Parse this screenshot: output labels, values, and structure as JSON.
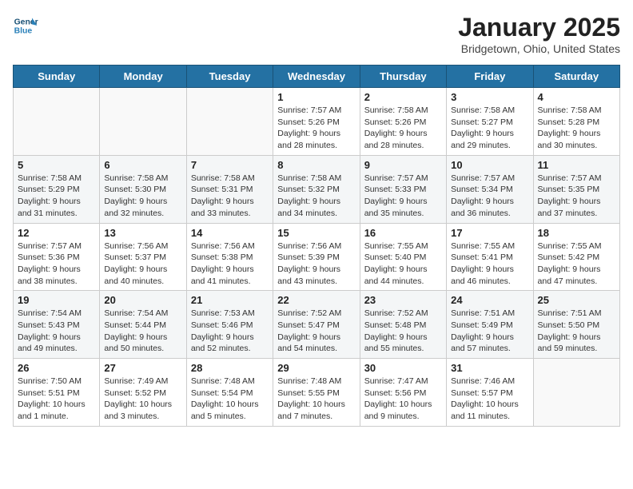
{
  "header": {
    "logo_line1": "General",
    "logo_line2": "Blue",
    "title": "January 2025",
    "subtitle": "Bridgetown, Ohio, United States"
  },
  "weekdays": [
    "Sunday",
    "Monday",
    "Tuesday",
    "Wednesday",
    "Thursday",
    "Friday",
    "Saturday"
  ],
  "weeks": [
    [
      {
        "day": "",
        "info": ""
      },
      {
        "day": "",
        "info": ""
      },
      {
        "day": "",
        "info": ""
      },
      {
        "day": "1",
        "info": "Sunrise: 7:57 AM\nSunset: 5:26 PM\nDaylight: 9 hours\nand 28 minutes."
      },
      {
        "day": "2",
        "info": "Sunrise: 7:58 AM\nSunset: 5:26 PM\nDaylight: 9 hours\nand 28 minutes."
      },
      {
        "day": "3",
        "info": "Sunrise: 7:58 AM\nSunset: 5:27 PM\nDaylight: 9 hours\nand 29 minutes."
      },
      {
        "day": "4",
        "info": "Sunrise: 7:58 AM\nSunset: 5:28 PM\nDaylight: 9 hours\nand 30 minutes."
      }
    ],
    [
      {
        "day": "5",
        "info": "Sunrise: 7:58 AM\nSunset: 5:29 PM\nDaylight: 9 hours\nand 31 minutes."
      },
      {
        "day": "6",
        "info": "Sunrise: 7:58 AM\nSunset: 5:30 PM\nDaylight: 9 hours\nand 32 minutes."
      },
      {
        "day": "7",
        "info": "Sunrise: 7:58 AM\nSunset: 5:31 PM\nDaylight: 9 hours\nand 33 minutes."
      },
      {
        "day": "8",
        "info": "Sunrise: 7:58 AM\nSunset: 5:32 PM\nDaylight: 9 hours\nand 34 minutes."
      },
      {
        "day": "9",
        "info": "Sunrise: 7:57 AM\nSunset: 5:33 PM\nDaylight: 9 hours\nand 35 minutes."
      },
      {
        "day": "10",
        "info": "Sunrise: 7:57 AM\nSunset: 5:34 PM\nDaylight: 9 hours\nand 36 minutes."
      },
      {
        "day": "11",
        "info": "Sunrise: 7:57 AM\nSunset: 5:35 PM\nDaylight: 9 hours\nand 37 minutes."
      }
    ],
    [
      {
        "day": "12",
        "info": "Sunrise: 7:57 AM\nSunset: 5:36 PM\nDaylight: 9 hours\nand 38 minutes."
      },
      {
        "day": "13",
        "info": "Sunrise: 7:56 AM\nSunset: 5:37 PM\nDaylight: 9 hours\nand 40 minutes."
      },
      {
        "day": "14",
        "info": "Sunrise: 7:56 AM\nSunset: 5:38 PM\nDaylight: 9 hours\nand 41 minutes."
      },
      {
        "day": "15",
        "info": "Sunrise: 7:56 AM\nSunset: 5:39 PM\nDaylight: 9 hours\nand 43 minutes."
      },
      {
        "day": "16",
        "info": "Sunrise: 7:55 AM\nSunset: 5:40 PM\nDaylight: 9 hours\nand 44 minutes."
      },
      {
        "day": "17",
        "info": "Sunrise: 7:55 AM\nSunset: 5:41 PM\nDaylight: 9 hours\nand 46 minutes."
      },
      {
        "day": "18",
        "info": "Sunrise: 7:55 AM\nSunset: 5:42 PM\nDaylight: 9 hours\nand 47 minutes."
      }
    ],
    [
      {
        "day": "19",
        "info": "Sunrise: 7:54 AM\nSunset: 5:43 PM\nDaylight: 9 hours\nand 49 minutes."
      },
      {
        "day": "20",
        "info": "Sunrise: 7:54 AM\nSunset: 5:44 PM\nDaylight: 9 hours\nand 50 minutes."
      },
      {
        "day": "21",
        "info": "Sunrise: 7:53 AM\nSunset: 5:46 PM\nDaylight: 9 hours\nand 52 minutes."
      },
      {
        "day": "22",
        "info": "Sunrise: 7:52 AM\nSunset: 5:47 PM\nDaylight: 9 hours\nand 54 minutes."
      },
      {
        "day": "23",
        "info": "Sunrise: 7:52 AM\nSunset: 5:48 PM\nDaylight: 9 hours\nand 55 minutes."
      },
      {
        "day": "24",
        "info": "Sunrise: 7:51 AM\nSunset: 5:49 PM\nDaylight: 9 hours\nand 57 minutes."
      },
      {
        "day": "25",
        "info": "Sunrise: 7:51 AM\nSunset: 5:50 PM\nDaylight: 9 hours\nand 59 minutes."
      }
    ],
    [
      {
        "day": "26",
        "info": "Sunrise: 7:50 AM\nSunset: 5:51 PM\nDaylight: 10 hours\nand 1 minute."
      },
      {
        "day": "27",
        "info": "Sunrise: 7:49 AM\nSunset: 5:52 PM\nDaylight: 10 hours\nand 3 minutes."
      },
      {
        "day": "28",
        "info": "Sunrise: 7:48 AM\nSunset: 5:54 PM\nDaylight: 10 hours\nand 5 minutes."
      },
      {
        "day": "29",
        "info": "Sunrise: 7:48 AM\nSunset: 5:55 PM\nDaylight: 10 hours\nand 7 minutes."
      },
      {
        "day": "30",
        "info": "Sunrise: 7:47 AM\nSunset: 5:56 PM\nDaylight: 10 hours\nand 9 minutes."
      },
      {
        "day": "31",
        "info": "Sunrise: 7:46 AM\nSunset: 5:57 PM\nDaylight: 10 hours\nand 11 minutes."
      },
      {
        "day": "",
        "info": ""
      }
    ]
  ]
}
